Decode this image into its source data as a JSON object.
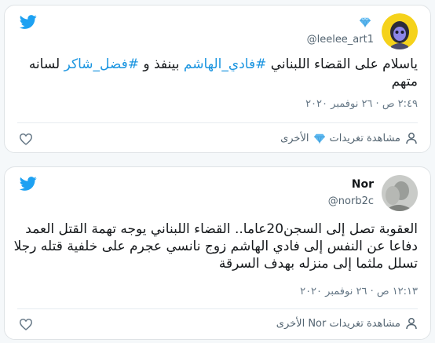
{
  "tweets": [
    {
      "display_name": "",
      "handle": "@leelee_art1",
      "text_before": "ياسلام على القضاء اللبناني ",
      "hashtag1": "#فادي_الهاشم",
      "text_mid": " بينفذ و ",
      "hashtag2": "#فضل_شاكر",
      "text_after": " لسانه متهم",
      "timestamp": "٢:٤٩ ص · ٢٦ نوفمبر ٢٠٢٠",
      "see_more_label": "مشاهدة تغريدات",
      "see_more_suffix": "الأخرى",
      "see_more_icon": "gem-icon"
    },
    {
      "display_name": "Nor",
      "handle": "@norb2c",
      "text": "العقوبة تصل إلى السجن20عاما.. القضاء اللبناني يوجه تهمة القتل العمد دفاعا عن النفس إلى فادي الهاشم زوج نانسي عجرم على خلفية قتله رجلا تسلل ملثما إلى منزله بهدف السرقة",
      "timestamp": "١٢:١٣ ص · ٢٦ نوفمبر ٢٠٢٠",
      "see_more_label": "مشاهدة تغريدات Nor الأخرى"
    }
  ],
  "colors": {
    "twitter_blue": "#1da1f2",
    "hashtag": "#1b95e0",
    "muted": "#657786"
  }
}
